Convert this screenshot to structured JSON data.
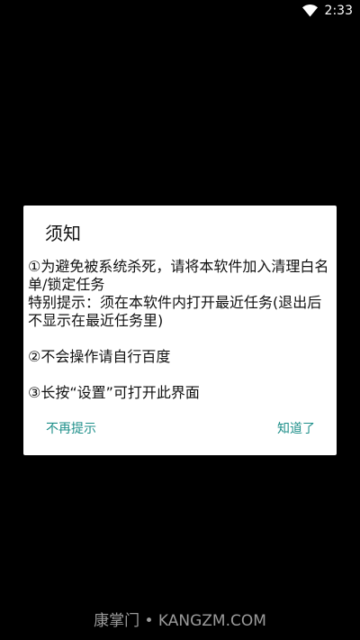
{
  "status_bar": {
    "time": "2:33",
    "wifi_icon": "wifi-icon"
  },
  "dialog": {
    "title": "须知",
    "paragraphs": [
      "①为避免被系统杀死，请将本软件加入清理白名单/锁定任务",
      "特别提示：须在本软件内打开最近任务(退出后不显示在最近任务里)",
      "②不会操作请自行百度",
      "③长按“设置”可打开此界面"
    ],
    "buttons": {
      "dismiss_forever": "不再提示",
      "ok": "知道了"
    },
    "accent_color": "#1e8f8a"
  },
  "watermark": {
    "text": "康掌门 • KANGZM.COM"
  }
}
